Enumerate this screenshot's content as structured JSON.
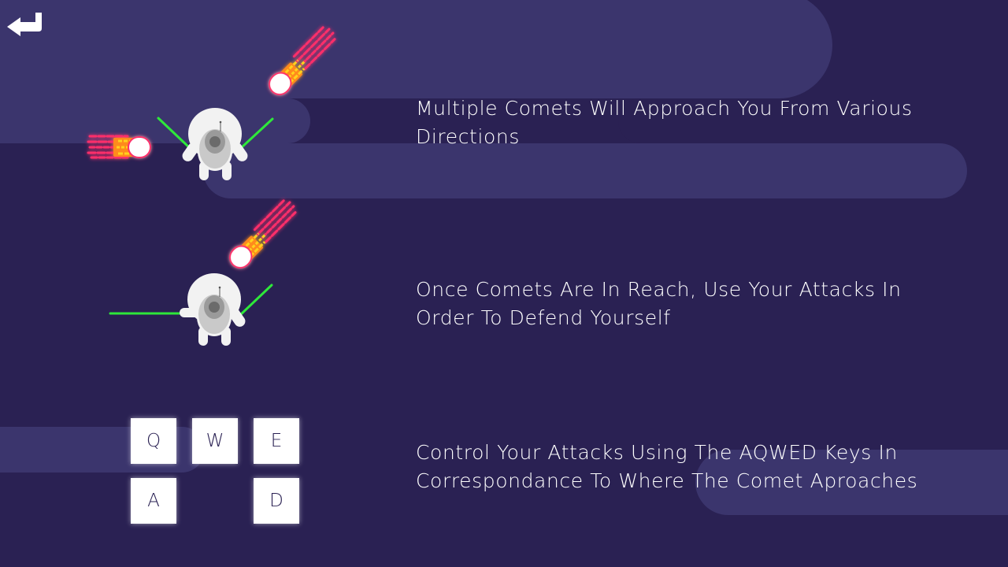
{
  "nav": {
    "back_icon": "return-arrow-icon"
  },
  "colors": {
    "background": "#2a2153",
    "band": "#3b356d",
    "saber": "#2ee83a",
    "comet_pink": "#ff2e6a",
    "comet_yellow": "#ffd21f",
    "astronaut_body": "#f2f2f2",
    "astronaut_pack": "#c9c9c9"
  },
  "instructions": [
    {
      "line1": "Multiple Comets Will Approach You From Various",
      "line2": "Directions"
    },
    {
      "line1": "Once Comets Are In Reach, Use Your Attacks In",
      "line2": "Order To Defend Yourself"
    },
    {
      "line1": "Control Your Attacks Using The AQWED Keys In",
      "line2": "Correspondance To Where The Comet Aproaches"
    }
  ],
  "keys": {
    "q": "Q",
    "w": "W",
    "e": "E",
    "a": "A",
    "d": "D"
  }
}
